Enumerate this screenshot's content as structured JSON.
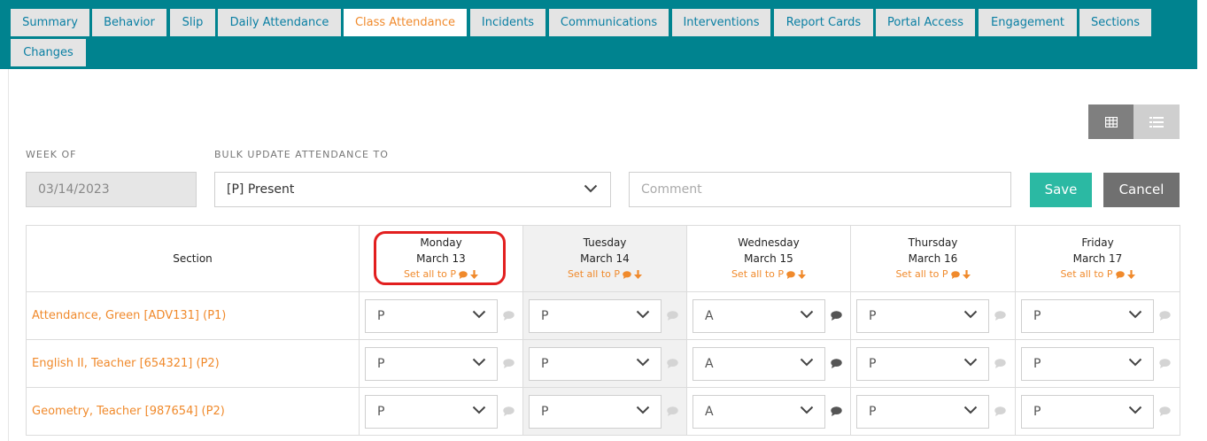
{
  "tabs": [
    {
      "label": "Summary",
      "active": false
    },
    {
      "label": "Behavior",
      "active": false
    },
    {
      "label": "Slip",
      "active": false
    },
    {
      "label": "Daily Attendance",
      "active": false
    },
    {
      "label": "Class Attendance",
      "active": true
    },
    {
      "label": "Incidents",
      "active": false
    },
    {
      "label": "Communications",
      "active": false
    },
    {
      "label": "Interventions",
      "active": false
    },
    {
      "label": "Report Cards",
      "active": false
    },
    {
      "label": "Portal Access",
      "active": false
    },
    {
      "label": "Engagement",
      "active": false
    },
    {
      "label": "Sections",
      "active": false
    },
    {
      "label": "Changes",
      "active": false
    }
  ],
  "view_toggle": {
    "grid_icon": "grid-icon",
    "list_icon": "list-icon",
    "selected": "grid"
  },
  "filters": {
    "week_label": "WEEK OF",
    "week_value": "03/14/2023",
    "bulk_label": "BULK UPDATE ATTENDANCE TO",
    "bulk_value": "[P] Present",
    "comment_placeholder": "Comment",
    "save_label": "Save",
    "cancel_label": "Cancel"
  },
  "table": {
    "section_header": "Section",
    "days": [
      {
        "name": "Monday",
        "date": "March 13",
        "set_all": "Set all to P"
      },
      {
        "name": "Tuesday",
        "date": "March 14",
        "set_all": "Set all to P"
      },
      {
        "name": "Wednesday",
        "date": "March 15",
        "set_all": "Set all to P"
      },
      {
        "name": "Thursday",
        "date": "March 16",
        "set_all": "Set all to P"
      },
      {
        "name": "Friday",
        "date": "March 17",
        "set_all": "Set all to P"
      }
    ],
    "rows": [
      {
        "section": "Attendance, Green [ADV131] (P1)",
        "values": [
          "P",
          "P",
          "A",
          "P",
          "P"
        ]
      },
      {
        "section": "English II, Teacher [654321] (P2)",
        "values": [
          "P",
          "P",
          "A",
          "P",
          "P"
        ]
      },
      {
        "section": "Geometry, Teacher [987654] (P2)",
        "values": [
          "P",
          "P",
          "A",
          "P",
          "P"
        ]
      }
    ]
  },
  "colors": {
    "teal_bar": "#00838f",
    "accent_orange": "#f08a2c",
    "save_green": "#2bb9a3",
    "cancel_gray": "#707070",
    "highlight_red": "#e21f1f"
  }
}
